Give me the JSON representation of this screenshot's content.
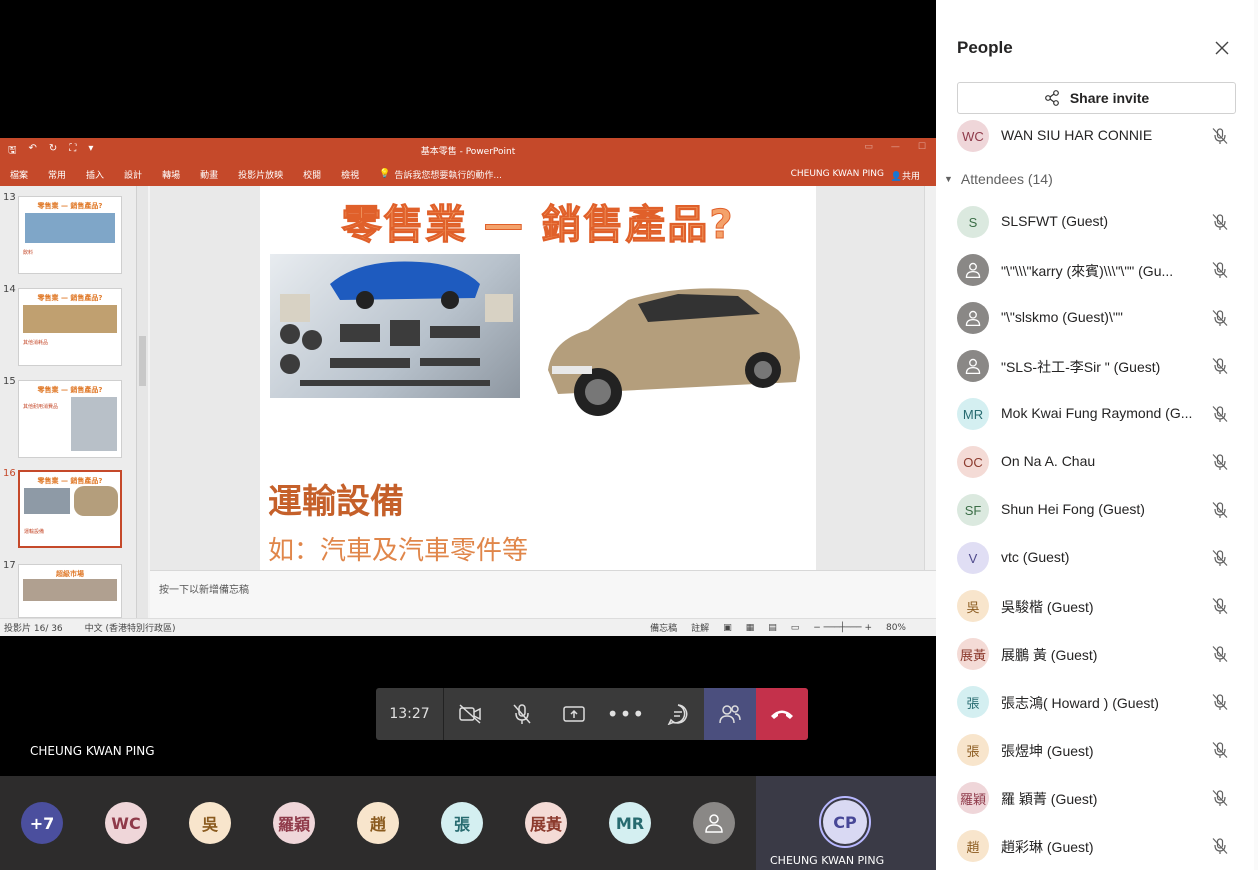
{
  "ppt": {
    "doc_title": "基本零售 - PowerPoint",
    "tabs": [
      "檔案",
      "常用",
      "插入",
      "設計",
      "轉場",
      "動畫",
      "投影片放映",
      "校閱",
      "檢視"
    ],
    "tell_me": "告訴我您想要執行的動作...",
    "user": "CHEUNG KWAN PING",
    "share": "共用",
    "thumbs": [
      {
        "num": "13",
        "title": "零售業 — 銷售產品?",
        "sub": "飲料"
      },
      {
        "num": "14",
        "title": "零售業 — 銷售產品?",
        "sub": "其他消耗品"
      },
      {
        "num": "15",
        "title": "零售業 — 銷售產品?",
        "sub": "其他耐用消費品"
      },
      {
        "num": "16",
        "title": "零售業 — 銷售產品?",
        "sub": "運輸設備"
      },
      {
        "num": "17",
        "title": "超級市場",
        "sub": ""
      }
    ],
    "slide": {
      "title": "零售業 — 銷售產品?",
      "heading": "運輸設備",
      "body": "如：汽車及汽車零件等"
    },
    "notes_placeholder": "按一下以新增備忘稿",
    "status": {
      "slide_pos": "投影片 16/ 36",
      "language": "中文 (香港特別行政區)",
      "notes": "備忘稿",
      "comments": "註解",
      "zoom": "80%"
    }
  },
  "call": {
    "time": "13:27",
    "presenter": "CHEUNG KWAN PING",
    "strip": [
      {
        "label": "+7",
        "bg": "#4b4f9e",
        "fg": "#ffffff"
      },
      {
        "label": "WC",
        "bg": "#efd6d9",
        "fg": "#8f3a4a"
      },
      {
        "label": "吳",
        "bg": "#f8e5cc",
        "fg": "#8a5a1e"
      },
      {
        "label": "羅穎",
        "bg": "#efd6d9",
        "fg": "#8f3a4a"
      },
      {
        "label": "趙",
        "bg": "#f8e5cc",
        "fg": "#8a5a1e"
      },
      {
        "label": "張",
        "bg": "#d4eff1",
        "fg": "#276b70"
      },
      {
        "label": "展黃",
        "bg": "#f4dbd6",
        "fg": "#8c3b2e"
      },
      {
        "label": "MR",
        "bg": "#d4eff1",
        "fg": "#276b70"
      },
      {
        "label": "",
        "bg": "#8a8886",
        "fg": "#ffffff"
      }
    ],
    "self": {
      "initials": "CP",
      "name": "CHEUNG KWAN PING"
    }
  },
  "panel": {
    "title": "People",
    "share_invite": "Share invite",
    "organizer": {
      "initials": "WC",
      "name": "WAN SIU HAR CONNIE",
      "bg": "#efd6d9",
      "fg": "#8f3a4a"
    },
    "attendees_label": "Attendees (14)",
    "attendees": [
      {
        "initials": "S",
        "name": "SLSFWT (Guest)",
        "bg": "#dbe9df",
        "fg": "#3b6e47"
      },
      {
        "initials": "",
        "name": "\"\\\"\\\\\\\"karry (來賓)\\\\\\\"\\\"\" (Gu...",
        "bg": "#8a8886",
        "fg": "#ffffff"
      },
      {
        "initials": "",
        "name": "\"\\\"slskmo (Guest)\\\"\"",
        "bg": "#8a8886",
        "fg": "#ffffff"
      },
      {
        "initials": "",
        "name": "\"SLS-社工-李Sir \" (Guest)",
        "bg": "#8a8886",
        "fg": "#ffffff"
      },
      {
        "initials": "MR",
        "name": "Mok Kwai Fung Raymond (G...",
        "bg": "#d4eff1",
        "fg": "#276b70"
      },
      {
        "initials": "OC",
        "name": "On Na A. Chau",
        "bg": "#f4dbd6",
        "fg": "#8c3b2e"
      },
      {
        "initials": "SF",
        "name": "Shun Hei Fong (Guest)",
        "bg": "#dbe9df",
        "fg": "#3b6e47"
      },
      {
        "initials": "V",
        "name": "vtc (Guest)",
        "bg": "#e0def4",
        "fg": "#4f4a8c"
      },
      {
        "initials": "吳",
        "name": "吳駿楷 (Guest)",
        "bg": "#f8e5cc",
        "fg": "#8a5a1e"
      },
      {
        "initials": "展黃",
        "name": "展鵬 黃 (Guest)",
        "bg": "#f4dbd6",
        "fg": "#8c3b2e"
      },
      {
        "initials": "張",
        "name": "張志鴻( Howard ) (Guest)",
        "bg": "#d4eff1",
        "fg": "#276b70"
      },
      {
        "initials": "張",
        "name": "張煜坤 (Guest)",
        "bg": "#f8e5cc",
        "fg": "#8a5a1e"
      },
      {
        "initials": "羅穎",
        "name": "羅 穎菁 (Guest)",
        "bg": "#efd6d9",
        "fg": "#8f3a4a"
      },
      {
        "initials": "趙",
        "name": "趙彩琳 (Guest)",
        "bg": "#f8e5cc",
        "fg": "#8a5a1e"
      }
    ]
  }
}
